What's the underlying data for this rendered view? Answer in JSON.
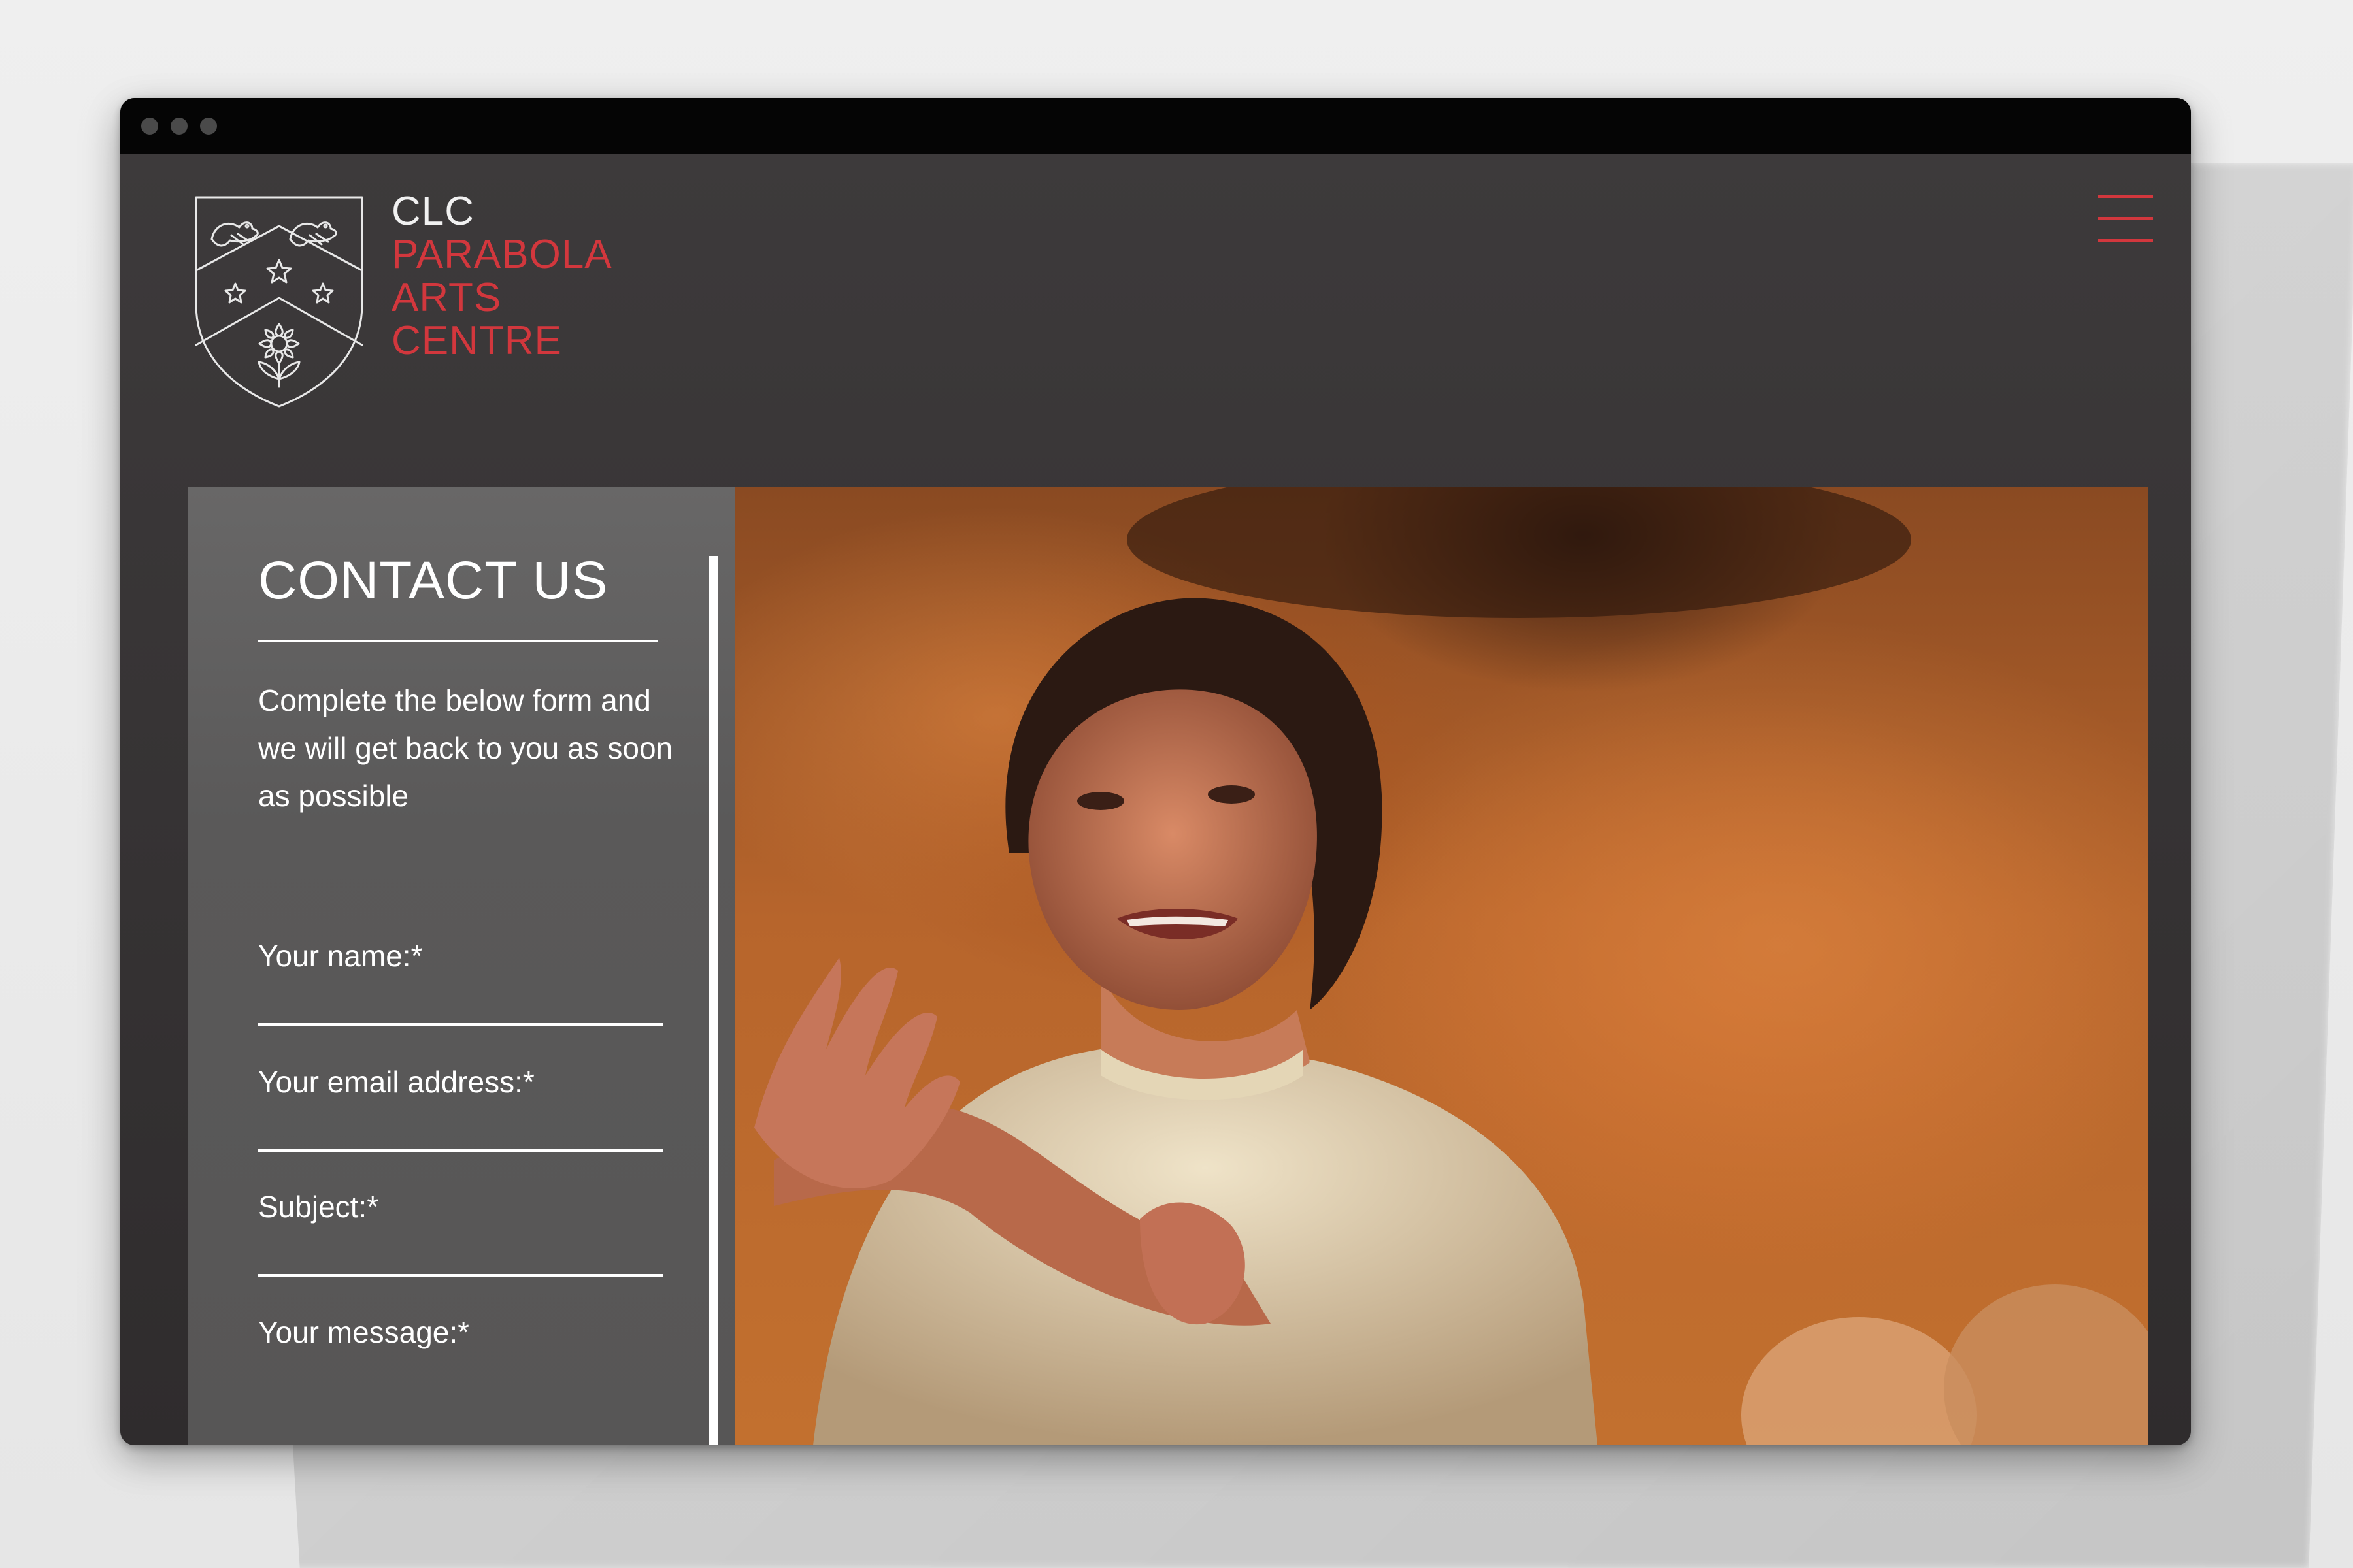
{
  "window": {
    "controls": [
      "close",
      "minimize",
      "maximize"
    ]
  },
  "header": {
    "brand_lines": [
      "CLC",
      "PARABOLA",
      "ARTS",
      "CENTRE"
    ],
    "logo_icon": "crest-shield-icon",
    "menu_icon": "hamburger-menu-icon"
  },
  "contact": {
    "title": "CONTACT US",
    "intro": "Complete the below form and we will get back to you as soon as possible",
    "fields": [
      {
        "label": "Your name:*",
        "value": ""
      },
      {
        "label": "Your email address:*",
        "value": ""
      },
      {
        "label": "Subject:*",
        "value": ""
      },
      {
        "label": "Your message:*",
        "value": ""
      }
    ]
  },
  "colors": {
    "accent": "#d2373d",
    "page_bg": "#3a3738",
    "panel_bg": "#5a5959",
    "text": "#ffffff"
  }
}
